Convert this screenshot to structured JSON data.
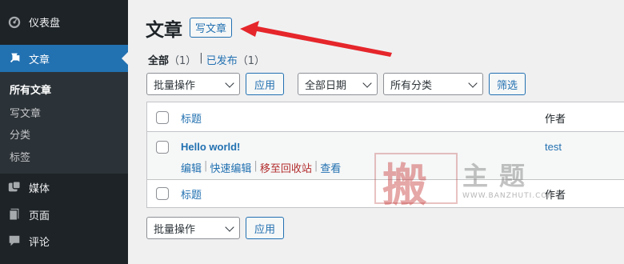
{
  "sidebar": {
    "items": [
      {
        "label": "仪表盘",
        "icon": "dashboard-icon"
      },
      {
        "label": "文章",
        "icon": "pin-icon"
      },
      {
        "label": "媒体",
        "icon": "media-icon"
      },
      {
        "label": "页面",
        "icon": "page-icon"
      },
      {
        "label": "评论",
        "icon": "comment-icon"
      }
    ],
    "submenu": [
      "所有文章",
      "写文章",
      "分类",
      "标签"
    ]
  },
  "header": {
    "title": "文章",
    "add_new": "写文章"
  },
  "filters_links": {
    "all": "全部",
    "all_count": "（1）",
    "sep": "|",
    "published": "已发布",
    "published_count": "（1）"
  },
  "toolbar_top": {
    "bulk_actions": "批量操作",
    "apply": "应用",
    "date_filter": "全部日期",
    "category_filter": "所有分类",
    "filter_button": "筛选"
  },
  "table": {
    "columns": {
      "title": "标题",
      "author": "作者"
    },
    "rows": [
      {
        "title": "Hello world!",
        "author": "test",
        "actions": [
          "编辑",
          "快速编辑",
          "移至回收站",
          "查看"
        ]
      }
    ]
  },
  "toolbar_bottom": {
    "bulk_actions": "批量操作",
    "apply": "应用"
  },
  "watermark": {
    "seal": "搬",
    "text": "主题",
    "url": "WWW.BANZHUTI.COM"
  },
  "colors": {
    "accent": "#2271b1",
    "sidebar": "#1d2327",
    "arrow": "#e5262b",
    "trash": "#b32d2e"
  }
}
